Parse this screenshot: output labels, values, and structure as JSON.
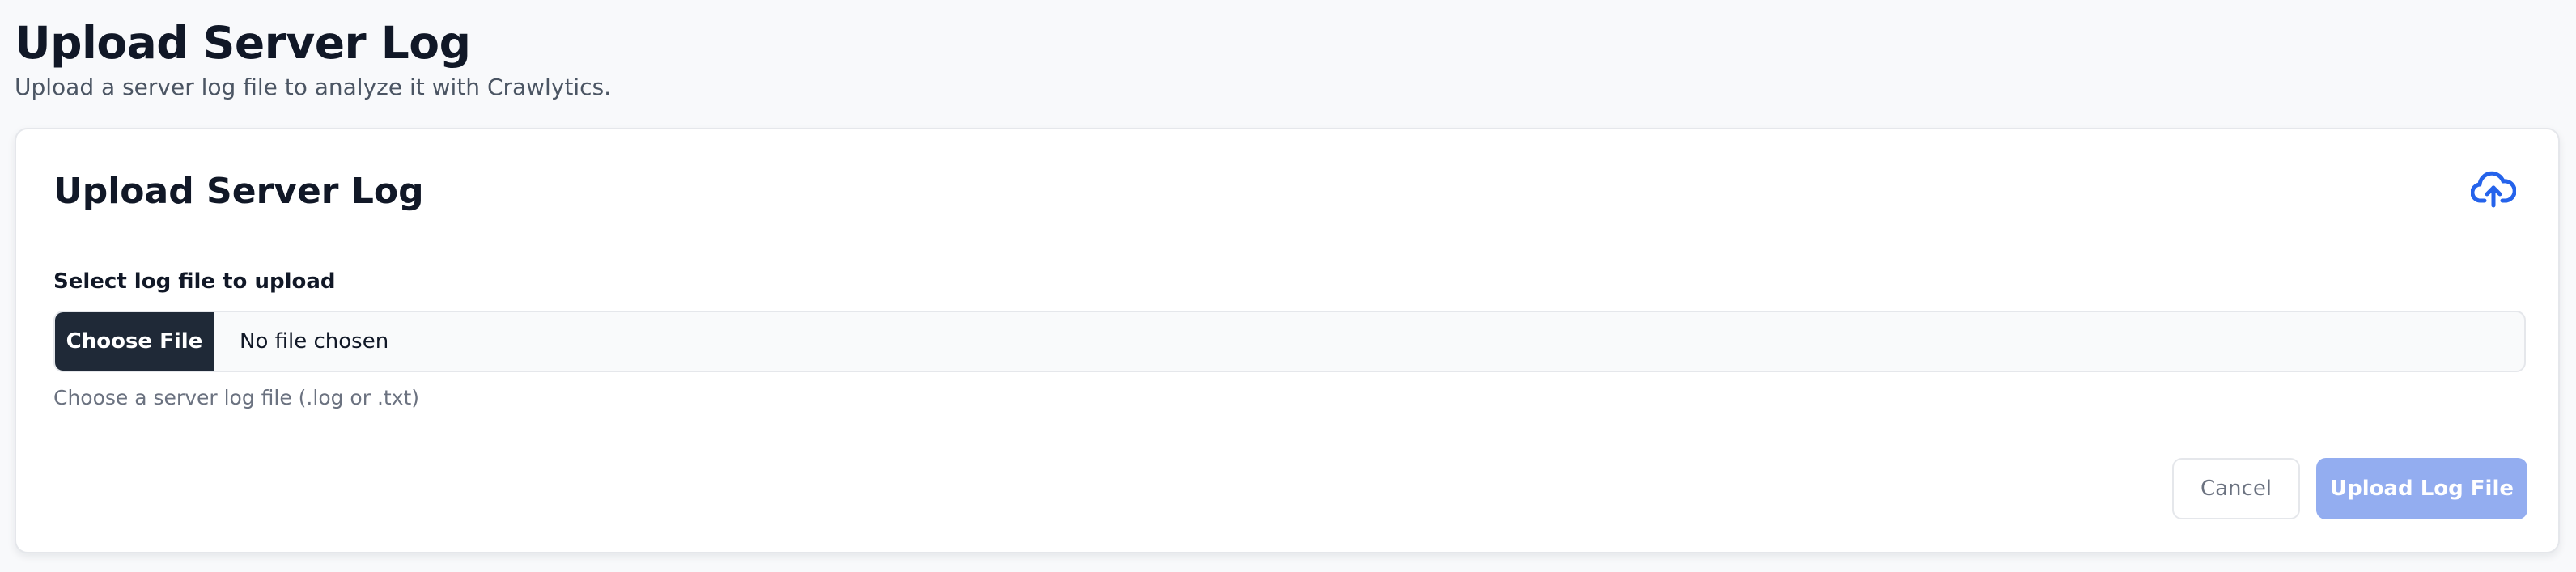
{
  "page": {
    "title": "Upload Server Log",
    "subtitle": "Upload a server log file to analyze it with Crawlytics."
  },
  "card": {
    "title": "Upload Server Log",
    "icon": "cloud-upload-icon",
    "field_label": "Select log file to upload",
    "file_input": {
      "button_label": "Choose File",
      "status": "No file chosen"
    },
    "help_text": "Choose a server log file (.log or .txt)",
    "actions": {
      "cancel_label": "Cancel",
      "submit_label": "Upload Log File"
    }
  },
  "colors": {
    "accent": "#2563eb",
    "submit_disabled": "#93adf0",
    "file_button": "#1f2937",
    "background": "#f8f9fb"
  }
}
